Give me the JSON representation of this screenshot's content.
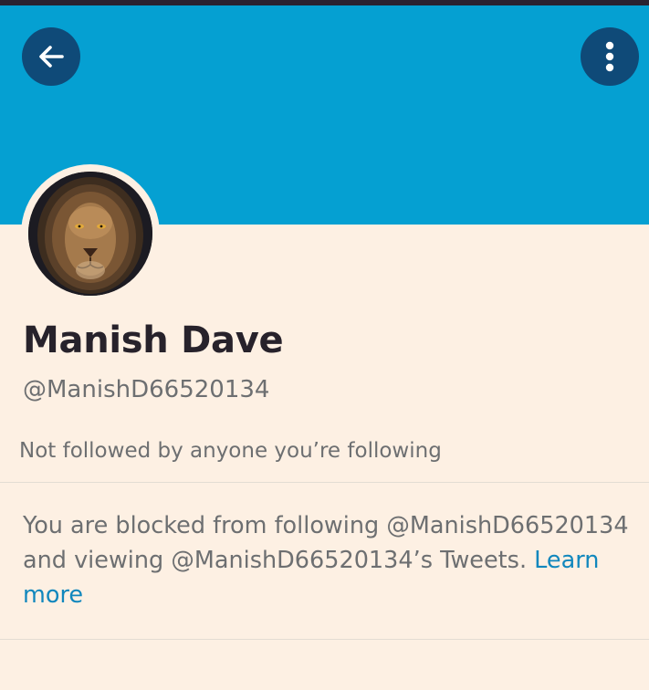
{
  "header": {
    "back_icon": "arrow-left-icon",
    "more_icon": "more-vertical-icon",
    "banner_color": "#05a0d2",
    "button_color": "#0f4a78"
  },
  "profile": {
    "avatar_alt": "lion",
    "name": "Manish Dave",
    "handle": "@ManishD66520134",
    "followed_by": "Not followed by anyone you’re following"
  },
  "notice": {
    "text": "You are blocked from following @ManishD66520134 and viewing @ManishD66520134’s Tweets. ",
    "link_label": "Learn more",
    "link_color": "#1187bd"
  }
}
